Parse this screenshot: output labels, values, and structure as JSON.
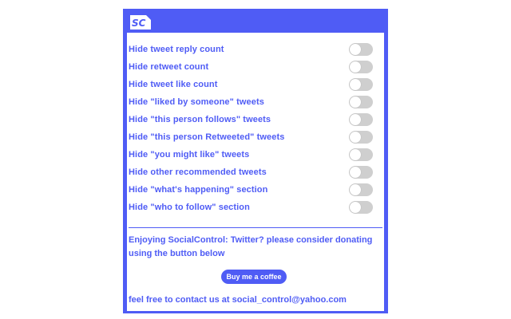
{
  "header": {
    "logo_text": "SC",
    "logo_icon": "sc-logo-icon"
  },
  "settings": [
    {
      "label": "Hide tweet reply count",
      "enabled": false
    },
    {
      "label": "Hide retweet count",
      "enabled": false
    },
    {
      "label": "Hide tweet like count",
      "enabled": false
    },
    {
      "label": "Hide \"liked by someone\" tweets",
      "enabled": false
    },
    {
      "label": "Hide \"this person follows\" tweets",
      "enabled": false
    },
    {
      "label": "Hide \"this person Retweeted\" tweets",
      "enabled": false
    },
    {
      "label": "Hide \"you might like\" tweets",
      "enabled": false
    },
    {
      "label": "Hide other recommended tweets",
      "enabled": false
    },
    {
      "label": "Hide \"what's happening\" section",
      "enabled": false
    },
    {
      "label": "Hide \"who to follow\" section",
      "enabled": false
    }
  ],
  "donate": {
    "message": "Enjoying SocialControl: Twitter? please consider donating using the button below",
    "button_label": "Buy me a coffee"
  },
  "contact": {
    "message": "feel free to contact us at social_control@yahoo.com"
  },
  "colors": {
    "accent": "#4f5cf5",
    "toggle_off": "#cfcfcf",
    "panel_bg": "#ffffff"
  }
}
